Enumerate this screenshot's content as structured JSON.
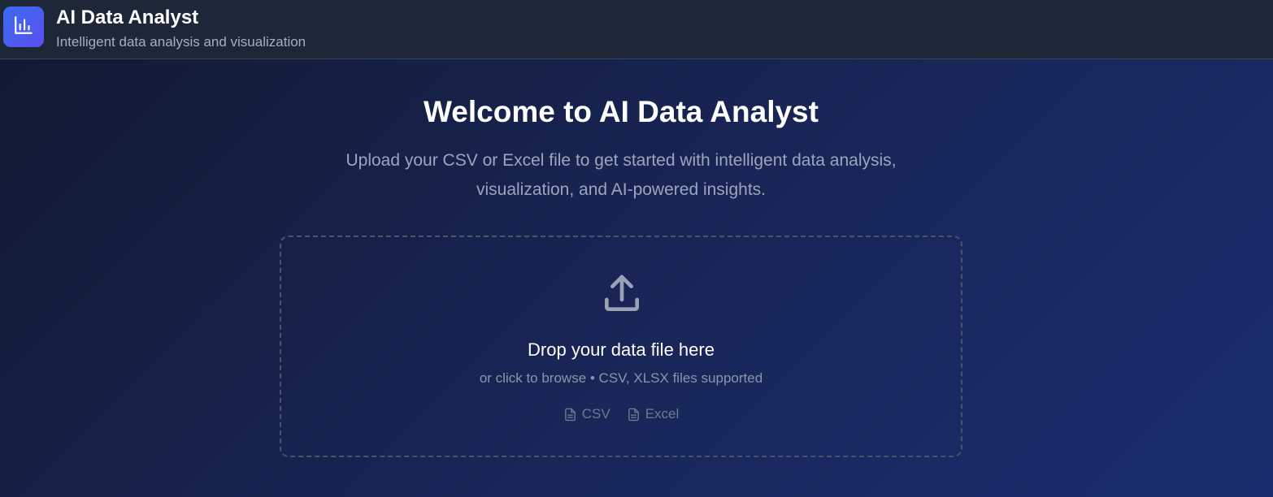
{
  "header": {
    "logo_icon": "bar-chart-icon",
    "title": "AI Data Analyst",
    "subtitle": "Intelligent data analysis and visualization"
  },
  "welcome": {
    "title": "Welcome to AI Data Analyst",
    "description": "Upload your CSV or Excel file to get started with intelligent data analysis, visualization, and AI-powered insights."
  },
  "dropzone": {
    "icon": "upload-icon",
    "title": "Drop your data file here",
    "hint": "or click to browse • CSV, XLSX files supported",
    "formats": [
      {
        "label": "CSV",
        "icon": "file-text-icon"
      },
      {
        "label": "Excel",
        "icon": "file-text-icon"
      }
    ]
  },
  "colors": {
    "accent": "#3b6cf0",
    "header_bg": "#1e2738",
    "background": "#172452"
  }
}
